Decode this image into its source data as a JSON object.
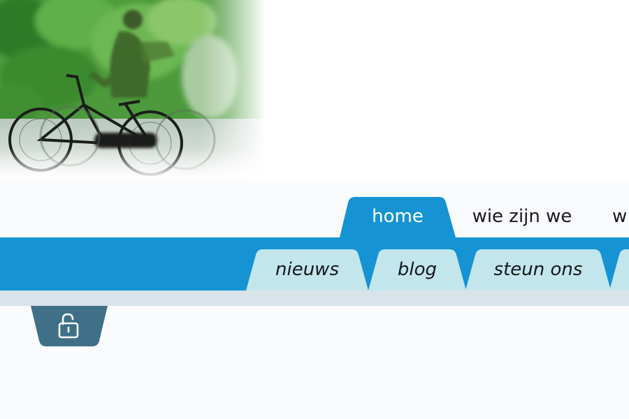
{
  "banner": {
    "image_name": "cyclist-photo"
  },
  "primary_nav": {
    "items": [
      {
        "label": "home",
        "active": true
      },
      {
        "label": "wie zijn we",
        "active": false
      },
      {
        "label": "w",
        "active": false
      }
    ]
  },
  "secondary_nav": {
    "items": [
      {
        "label": "nieuws"
      },
      {
        "label": "blog"
      },
      {
        "label": "steun ons"
      },
      {
        "label": ""
      }
    ]
  },
  "login": {
    "icon": "unlock-icon"
  },
  "colors": {
    "primary_blue": "#1693d2",
    "secondary_tab": "#c2e6ec",
    "login_tab": "#3f7088",
    "strip": "#d8e3ea",
    "page_bg": "#fafbfd"
  }
}
